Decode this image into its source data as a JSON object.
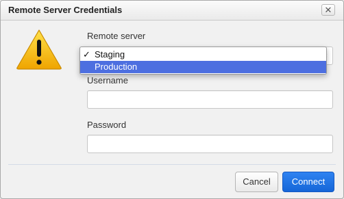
{
  "dialog": {
    "title": "Remote Server Credentials",
    "close_icon": "close-icon",
    "warning_icon": "warning-triangle-icon",
    "colors": {
      "accent": "#1a6fe6",
      "warning": "#f0b000",
      "selected_option": "#4d6fe0"
    }
  },
  "server": {
    "label": "Remote server",
    "selected": "Staging",
    "options": [
      {
        "label": "Staging",
        "checked": true
      },
      {
        "label": "Production",
        "checked": false,
        "highlighted": true
      }
    ],
    "check_mark": "✓"
  },
  "username": {
    "label": "Username",
    "value": ""
  },
  "password": {
    "label": "Password",
    "value": ""
  },
  "buttons": {
    "cancel": "Cancel",
    "connect": "Connect"
  }
}
